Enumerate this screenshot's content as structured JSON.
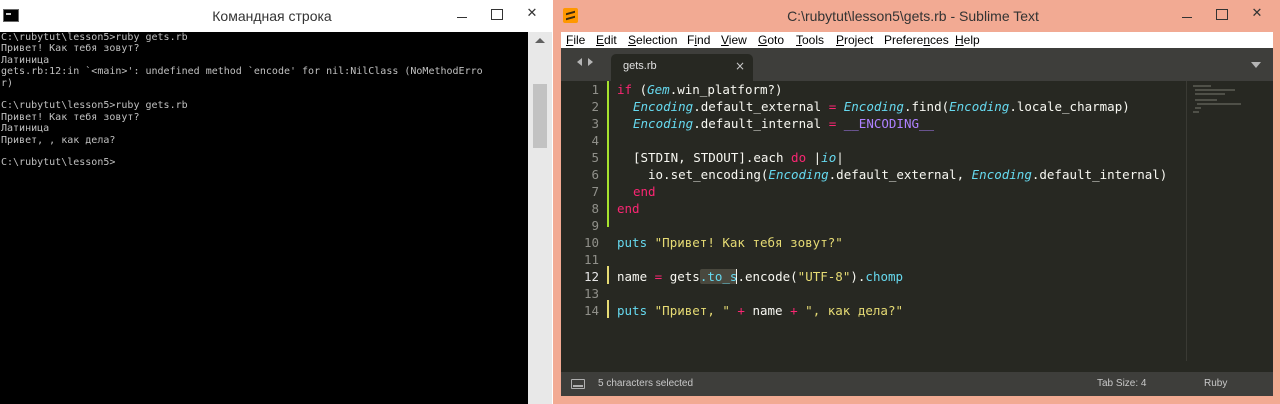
{
  "cmd_window": {
    "title": "Командная строка",
    "lines": [
      "C:\\rubytut\\lesson5>ruby gets.rb",
      "Привет! Как тебя зовут?",
      "Латиница",
      "gets.rb:12:in `<main>': undefined method `encode' for nil:NilClass (NoMethodErro",
      "r)",
      "",
      "C:\\rubytut\\lesson5>ruby gets.rb",
      "Привет! Как тебя зовут?",
      "Латиница",
      "Привет, , как дела?",
      "",
      "C:\\rubytut\\lesson5>"
    ]
  },
  "sublime_window": {
    "title": "C:\\rubytut\\lesson5\\gets.rb - Sublime Text",
    "menu": [
      {
        "accel": "F",
        "rest": "ile"
      },
      {
        "accel": "E",
        "rest": "dit"
      },
      {
        "accel": "S",
        "rest": "election"
      },
      {
        "accel": "",
        "pre": "F",
        "accel2": "i",
        "rest": "nd"
      },
      {
        "accel": "V",
        "rest": "iew"
      },
      {
        "accel": "G",
        "rest": "oto"
      },
      {
        "accel": "T",
        "rest": "ools"
      },
      {
        "accel": "P",
        "rest": "roject"
      },
      {
        "accel": "",
        "pre": "Prefere",
        "accel2": "n",
        "rest": "ces"
      },
      {
        "accel": "H",
        "rest": "elp"
      }
    ],
    "tab": {
      "label": "gets.rb",
      "close": "×"
    },
    "line_numbers": [
      "1",
      "2",
      "3",
      "4",
      "5",
      "6",
      "7",
      "8",
      "9",
      "10",
      "11",
      "12",
      "13",
      "14"
    ],
    "active_line": "12",
    "code": {
      "l1": {
        "kw_if": "if",
        "paren_open": " (",
        "cls": "Gem",
        "rest": ".win_platform?)"
      },
      "l2": {
        "cls1": "Encoding",
        "m1": ".default_external ",
        "op": "=",
        "sp": " ",
        "cls2": "Encoding",
        "m2": ".find(",
        "cls3": "Encoding",
        "m3": ".locale_charmap)"
      },
      "l3": {
        "cls1": "Encoding",
        "m1": ".default_internal ",
        "op": "=",
        "sp": " ",
        "const": "__ENCODING__"
      },
      "l5": {
        "a": "[STDIN, STDOUT].each ",
        "kw_do": "do",
        "b": " |",
        "var": "io",
        "c": "|"
      },
      "l6": {
        "a": "io.set_encoding(",
        "cls1": "Encoding",
        "m1": ".default_external, ",
        "cls2": "Encoding",
        "m2": ".default_internal)"
      },
      "l7": {
        "kw_end": "end"
      },
      "l8": {
        "kw_end": "end"
      },
      "l10": {
        "fn": "puts",
        "sp": " ",
        "str": "\"Привет! Как тебя зовут?\""
      },
      "l12": {
        "a": "name ",
        "op": "=",
        "sp": " ",
        "b": "gets",
        "sel": ".to_s",
        "c": ".encode(",
        "str": "\"UTF-8\"",
        "d": ").",
        "fn": "chomp"
      },
      "l14": {
        "fn": "puts",
        "sp": " ",
        "str1": "\"Привет, \"",
        "op1": " + ",
        "mid": "name",
        "op2": " + ",
        "str2": "\", как дела?\""
      }
    },
    "status": {
      "selection": "5 characters selected",
      "tab_size": "Tab Size: 4",
      "syntax": "Ruby"
    }
  }
}
